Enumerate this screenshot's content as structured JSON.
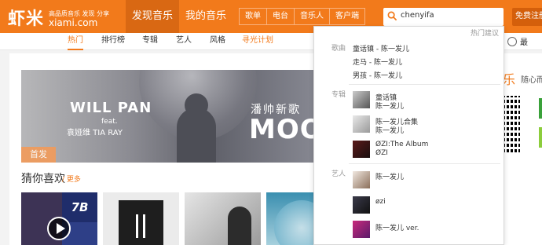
{
  "header": {
    "logo_cn": "虾米",
    "logo_tagline": "高品质音乐 发现 分享",
    "logo_en": "xiami.com",
    "nav": [
      "发现音乐",
      "我的音乐"
    ],
    "categories": [
      "歌单",
      "电台",
      "音乐人",
      "客户端"
    ],
    "search_value": "chenyifa",
    "register_label": "免费注册"
  },
  "subnav": {
    "items": [
      "热门",
      "排行榜",
      "专辑",
      "艺人",
      "风格",
      "寻光计划"
    ],
    "right_text": "最"
  },
  "banner": {
    "title_en": "WILL PAN",
    "feat": "feat.",
    "title_cn": "袁娅维 TIA RAY",
    "headline_cn": "潘帅新歌",
    "headline_en": "MOON",
    "badge": "首发"
  },
  "main": {
    "section_title": "猜你喜欢",
    "section_more": "/ 更多"
  },
  "sidebar": {
    "title": "乐",
    "subtitle": "随心而"
  },
  "dropdown": {
    "hint": "热门建议",
    "songs_label": "歌曲",
    "songs": [
      "童话镇 - 陈一发儿",
      "走马 - 陈一发儿",
      "男孩 - 陈一发儿"
    ],
    "albums_label": "专辑",
    "albums": [
      {
        "name": "童话镇",
        "artist": "陈一发儿"
      },
      {
        "name": "陈一发儿合集",
        "artist": "陈一发儿"
      },
      {
        "name": "ØZI:The Album",
        "artist": "ØZI"
      }
    ],
    "artists_label": "艺人",
    "artists": [
      "陈一发儿",
      "øzi",
      "陈一发儿 ver."
    ]
  },
  "colors": {
    "brand_orange": "#f27a1b",
    "header_active": "#d96813"
  }
}
